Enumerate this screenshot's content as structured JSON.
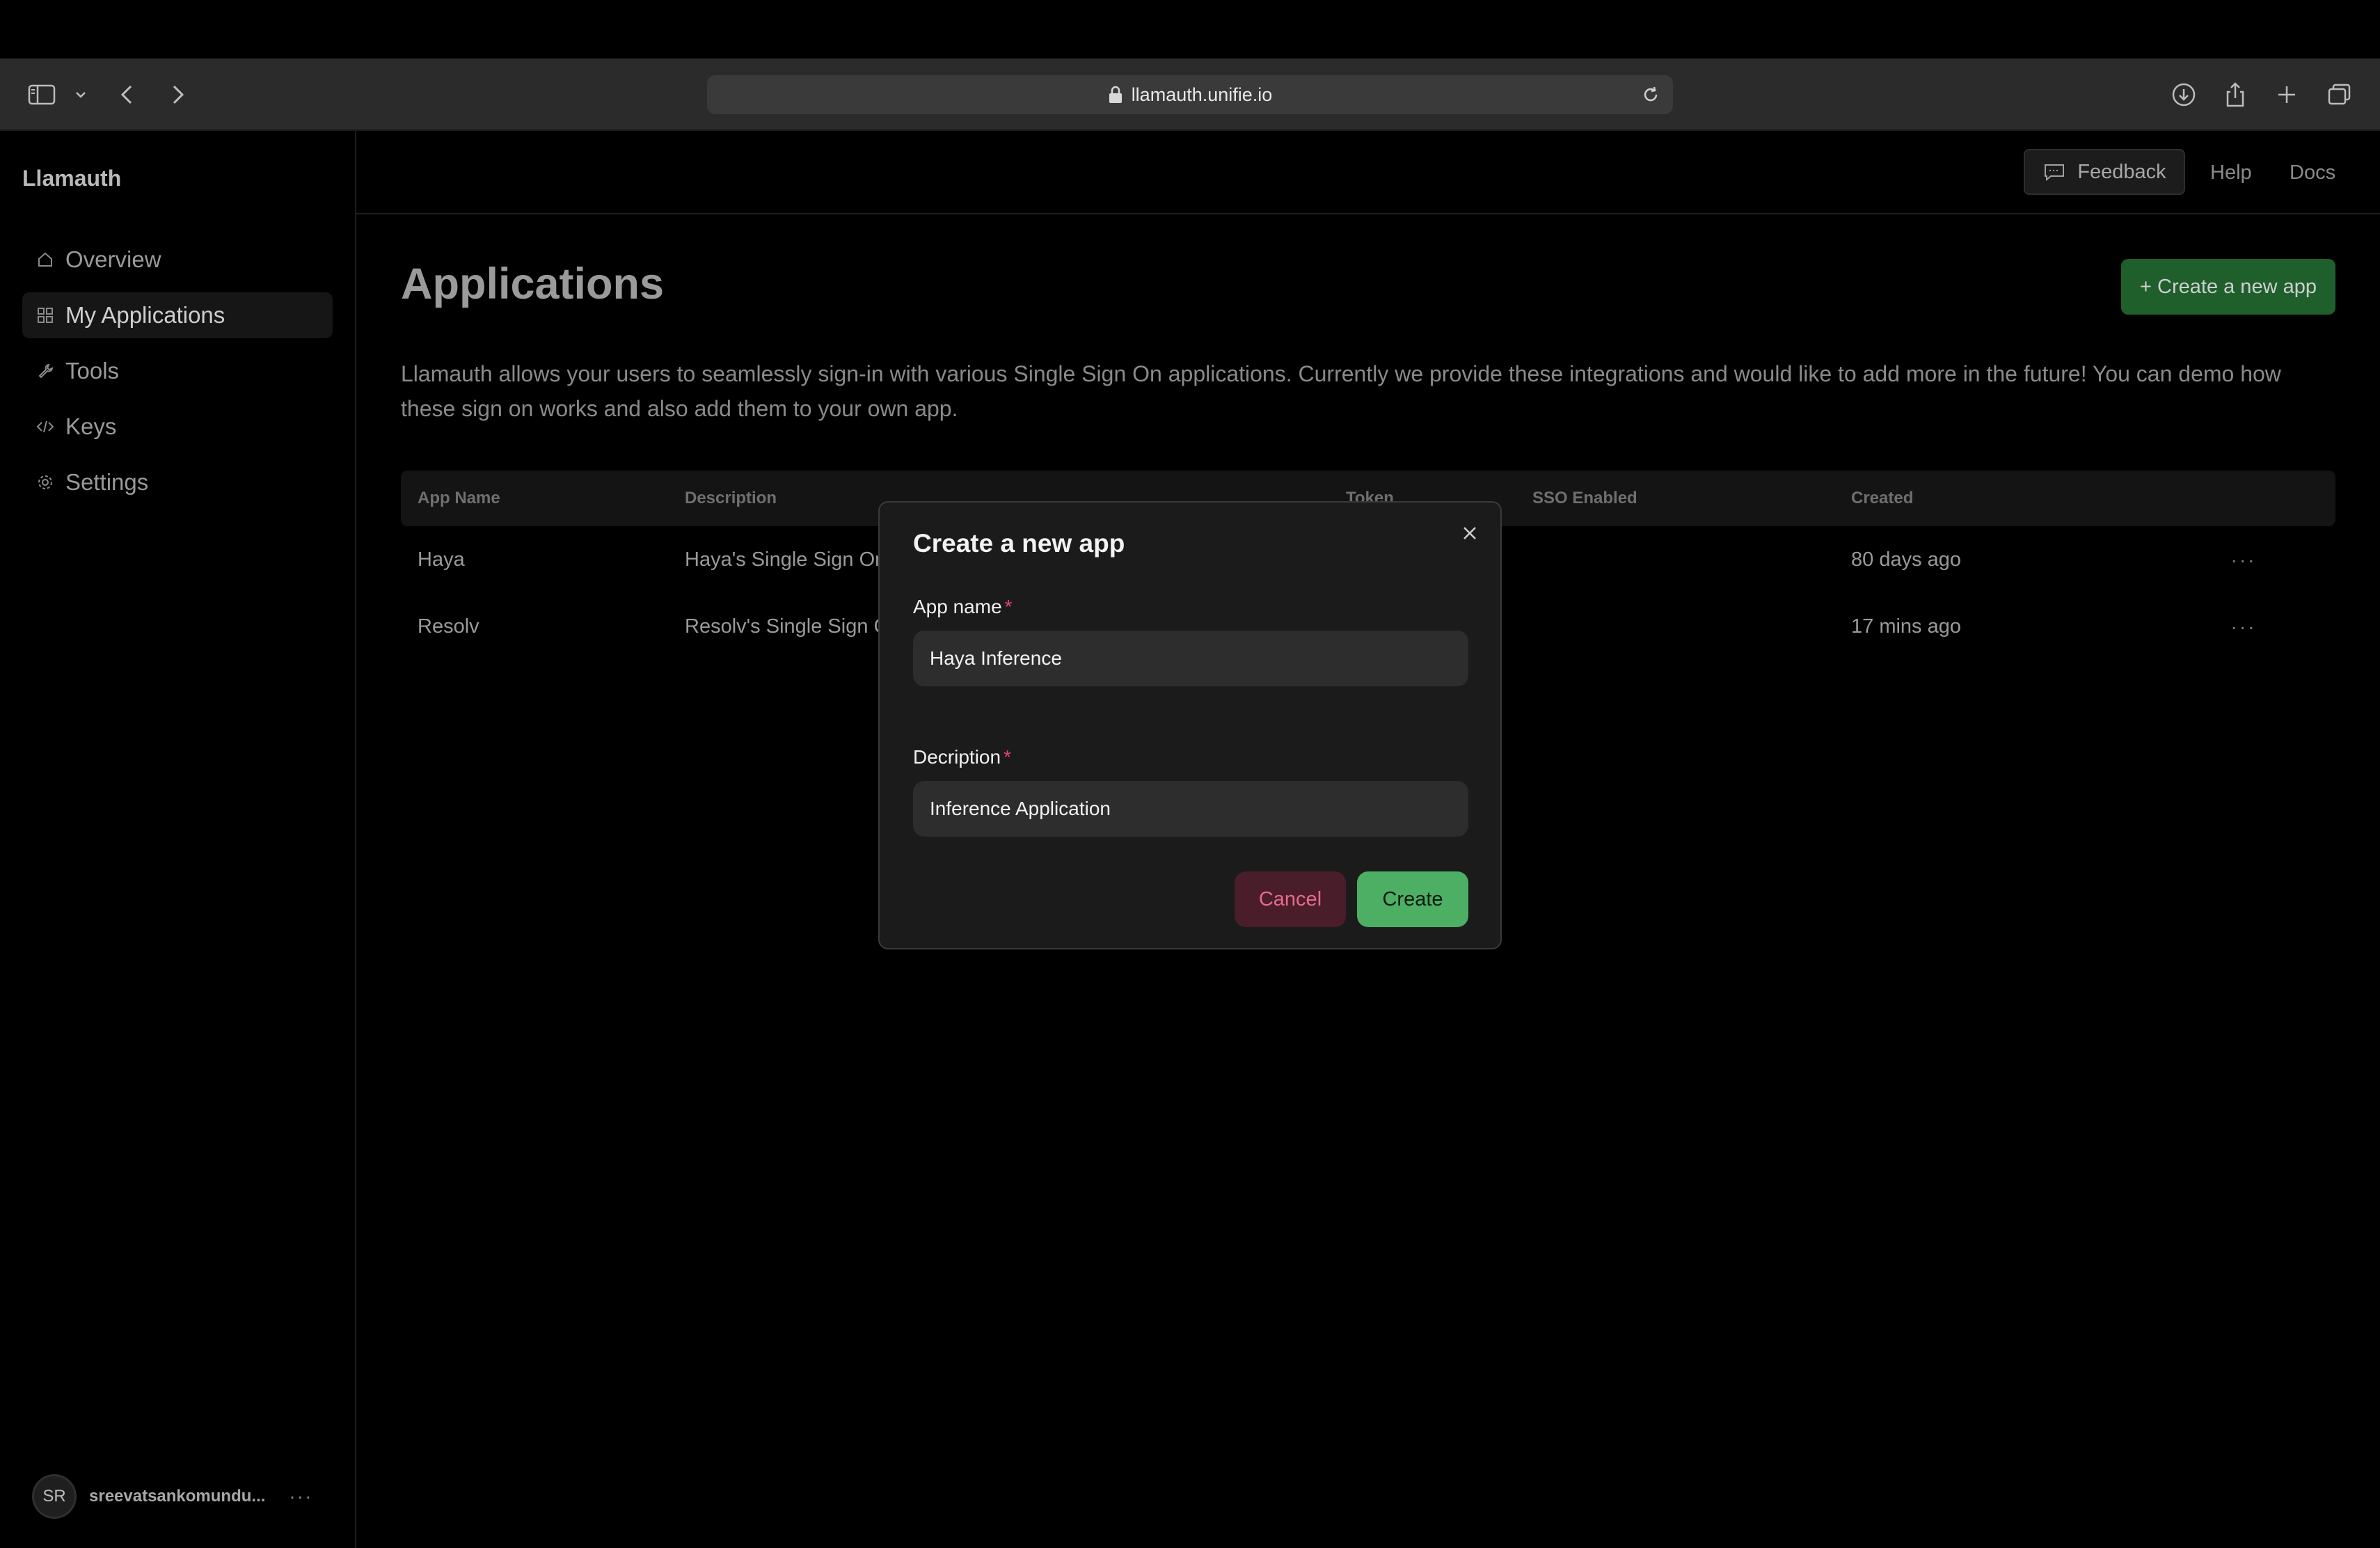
{
  "browser": {
    "url": "llamauth.unifie.io",
    "icons": [
      "sidebar-toggle-icon",
      "chevron-down-icon",
      "back-icon",
      "forward-icon",
      "lock-icon",
      "reload-icon",
      "download-icon",
      "share-icon",
      "new-tab-icon",
      "tabs-overview-icon"
    ]
  },
  "sidebar": {
    "brand": "Llamauth",
    "items": [
      {
        "label": "Overview",
        "icon": "home-icon",
        "active": false
      },
      {
        "label": "My Applications",
        "icon": "grid-icon",
        "active": true
      },
      {
        "label": "Tools",
        "icon": "wrench-icon",
        "active": false
      },
      {
        "label": "Keys",
        "icon": "code-icon",
        "active": false
      },
      {
        "label": "Settings",
        "icon": "gear-icon",
        "active": false
      }
    ],
    "user": {
      "initials": "SR",
      "name": "sreevatsankomundu...",
      "more": "···"
    }
  },
  "header": {
    "feedback": "Feedback",
    "help": "Help",
    "docs": "Docs"
  },
  "main": {
    "title": "Applications",
    "create_button": "+ Create a new app",
    "intro": "Llamauth allows your users to seamlessly sign-in with various Single Sign On applications. Currently we provide these integrations and would like to add more in the future! You can demo how these sign on works and also add them to your own app.",
    "table": {
      "headers": {
        "app_name": "App Name",
        "description": "Description",
        "token": "Token",
        "sso": "SSO Enabled",
        "created": "Created"
      },
      "rows": [
        {
          "app_name": "Haya",
          "description": "Haya's Single Sign On",
          "created": "80 days ago",
          "actions": "..."
        },
        {
          "app_name": "Resolv",
          "description": "Resolv's Single Sign C",
          "created": "17 mins ago",
          "actions": "..."
        }
      ]
    }
  },
  "modal": {
    "title": "Create a new app",
    "app_name_label": "App name",
    "app_name_value": "Haya Inference",
    "description_label": "Decription",
    "description_value": "Inference Application",
    "required_mark": "*",
    "cancel": "Cancel",
    "create": "Create"
  },
  "colors": {
    "background": "#000000",
    "accent_green": "#4caf63",
    "cancel_pink": "#e56b8d",
    "create_app_green": "#1f5f2c"
  }
}
